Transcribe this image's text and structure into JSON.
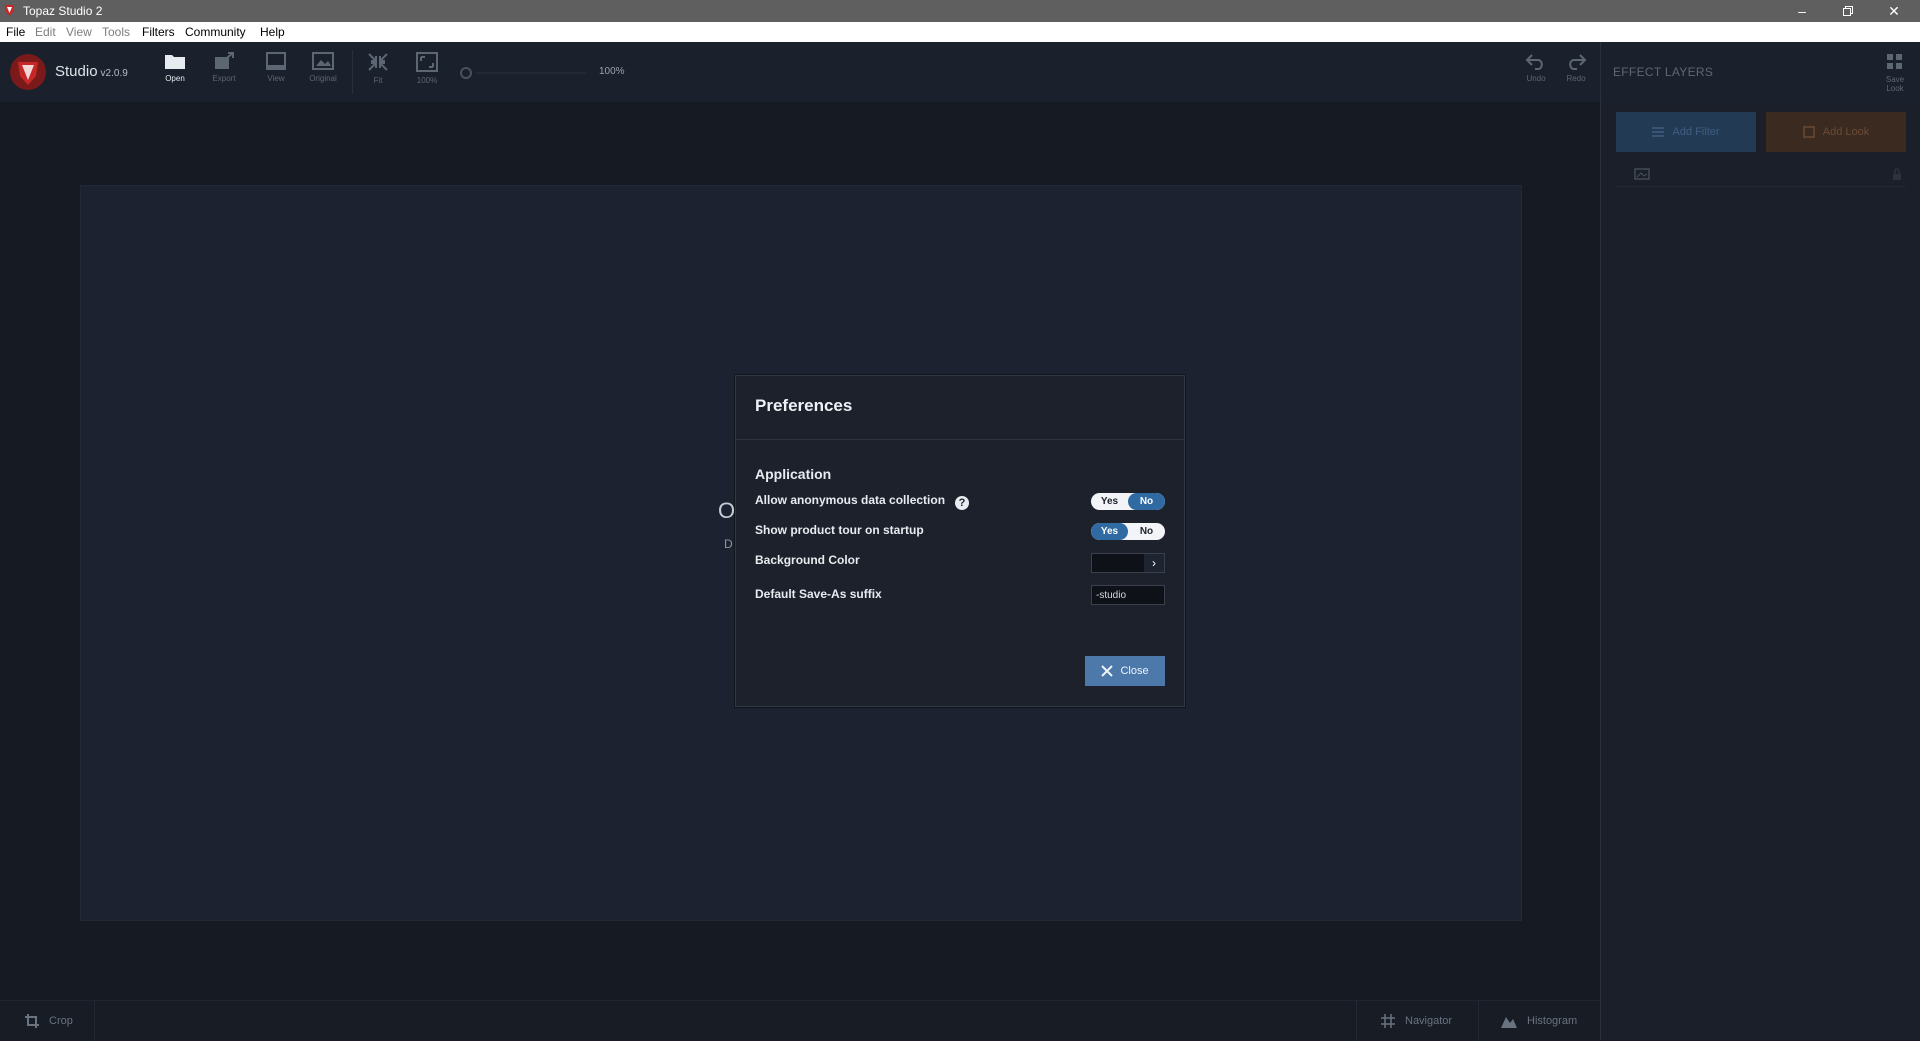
{
  "window": {
    "title": "Topaz Studio 2"
  },
  "menu": [
    {
      "label": "File",
      "enabled": true
    },
    {
      "label": "Edit",
      "enabled": false
    },
    {
      "label": "View",
      "enabled": false
    },
    {
      "label": "Tools",
      "enabled": false
    },
    {
      "label": "Filters",
      "enabled": true
    },
    {
      "label": "Community",
      "enabled": true
    },
    {
      "label": "Help",
      "enabled": true
    }
  ],
  "toolbar": {
    "app_name": "Studio",
    "version": "v2.0.9",
    "open": "Open",
    "export": "Export",
    "view": "View",
    "original": "Original",
    "fit": "Fit",
    "zoom100": "100%",
    "zoom_value": "100%",
    "undo": "Undo",
    "redo": "Redo"
  },
  "right_panel": {
    "header": "EFFECT LAYERS",
    "save_look": "Save Look",
    "add_filter": "Add Filter",
    "add_look": "Add Look"
  },
  "canvas": {
    "hint_initial": "O",
    "hint_sub": "D"
  },
  "bottom": {
    "crop": "Crop",
    "navigator": "Navigator",
    "histogram": "Histogram"
  },
  "dialog": {
    "title": "Preferences",
    "section": "Application",
    "allow_data_label": "Allow anonymous data collection",
    "allow_data_value": "No",
    "tour_label": "Show product tour on startup",
    "tour_value": "Yes",
    "yes": "Yes",
    "no": "No",
    "help_glyph": "?",
    "bg_color_label": "Background Color",
    "bg_color_value": "#0e1117",
    "suffix_label": "Default Save-As suffix",
    "suffix_value": "-studio",
    "close": "Close"
  },
  "colors": {
    "accent_blue": "#2f6aa3",
    "close_button": "#4c78aa",
    "add_filter_bg": "#233a55",
    "add_look_bg": "#3b2a1f",
    "brand_red": "#c62828"
  }
}
